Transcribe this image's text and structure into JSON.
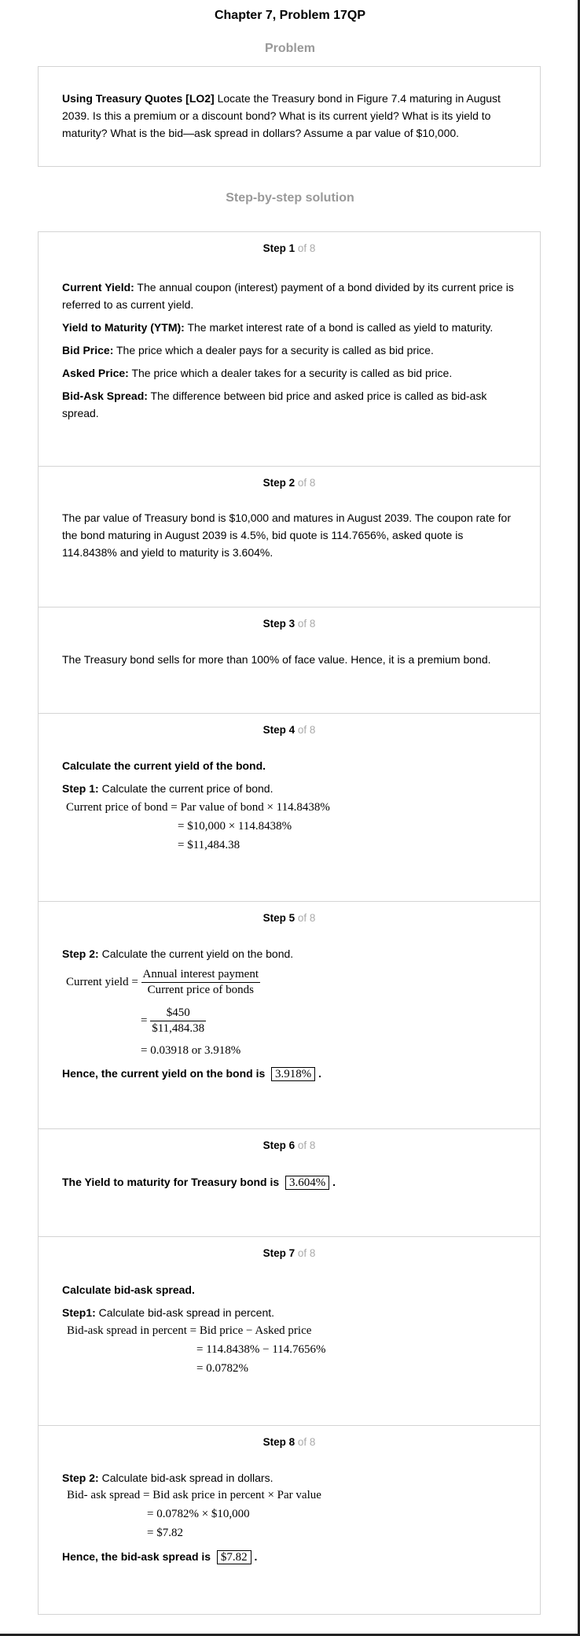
{
  "title": "Chapter 7, Problem 17QP",
  "problem_heading": "Problem",
  "problem": {
    "bold": "Using Treasury Quotes [LO2]",
    "text": " Locate the Treasury bond in Figure 7.4 maturing in August 2039. Is this a premium or a discount bond? What is its current yield? What is its yield to maturity? What is the bid—ask spread in dollars? Assume a par value of $10,000."
  },
  "solution_heading": "Step-by-step solution",
  "step_of": "of 8",
  "steps": {
    "s1": {
      "label": "Step 1",
      "defs": [
        {
          "term": "Current Yield:",
          "text": " The annual coupon (interest) payment of a bond divided by its current price is referred to as current yield."
        },
        {
          "term": "Yield to Maturity (YTM):",
          "text": " The market interest rate of a bond is called as yield to maturity."
        },
        {
          "term": "Bid Price:",
          "text": " The price which a dealer pays for a security is called as bid price."
        },
        {
          "term": "Asked Price:",
          "text": " The price which a dealer takes for a security is called as bid price."
        },
        {
          "term": "Bid-Ask Spread:",
          "text": " The difference between bid price and asked price is called as bid-ask spread."
        }
      ]
    },
    "s2": {
      "label": "Step 2",
      "text": "The par value of Treasury bond is $10,000 and matures in August 2039. The coupon rate for the bond maturing in August 2039 is 4.5%, bid quote is 114.7656%, asked quote is 114.8438% and yield to maturity is 3.604%."
    },
    "s3": {
      "label": "Step 3",
      "text": "The Treasury bond sells for more than 100% of face value. Hence, it is a premium bond."
    },
    "s4": {
      "label": "Step 4",
      "heading": "Calculate the current yield of the bond.",
      "sub_bold": "Step 1:",
      "sub_text": " Calculate the current price of bond.",
      "eq1": "Current price of bond = Par value of bond × 114.8438%",
      "eq2": "= $10,000 × 114.8438%",
      "eq3": "= $11,484.38"
    },
    "s5": {
      "label": "Step 5",
      "sub_bold": "Step 2:",
      "sub_text": " Calculate the current yield on the bond.",
      "lhs": "Current yield =",
      "num1": "Annual interest payment",
      "den1": "Current price of bonds",
      "num2": "$450",
      "den2": "$11,484.38",
      "eq3": "= 0.03918 or 3.918%",
      "conclusion": "Hence, the current yield on the bond is",
      "answer": "3.918%"
    },
    "s6": {
      "label": "Step 6",
      "conclusion": "The Yield to maturity for Treasury bond is",
      "answer": "3.604%"
    },
    "s7": {
      "label": "Step 7",
      "heading": "Calculate bid-ask spread.",
      "sub_bold": "Step1:",
      "sub_text": " Calculate bid-ask spread in percent.",
      "eq1": "Bid-ask spread in percent = Bid price − Asked price",
      "eq2": "= 114.8438% − 114.7656%",
      "eq3": "= 0.0782%"
    },
    "s8": {
      "label": "Step 8",
      "sub_bold": "Step 2:",
      "sub_text": " Calculate bid-ask spread in dollars.",
      "eq1": "Bid- ask spread = Bid ask price in percent × Par value",
      "eq2": "= 0.0782% × $10,000",
      "eq3": "= $7.82",
      "conclusion": "Hence, the bid-ask spread is",
      "answer": "$7.82"
    }
  }
}
